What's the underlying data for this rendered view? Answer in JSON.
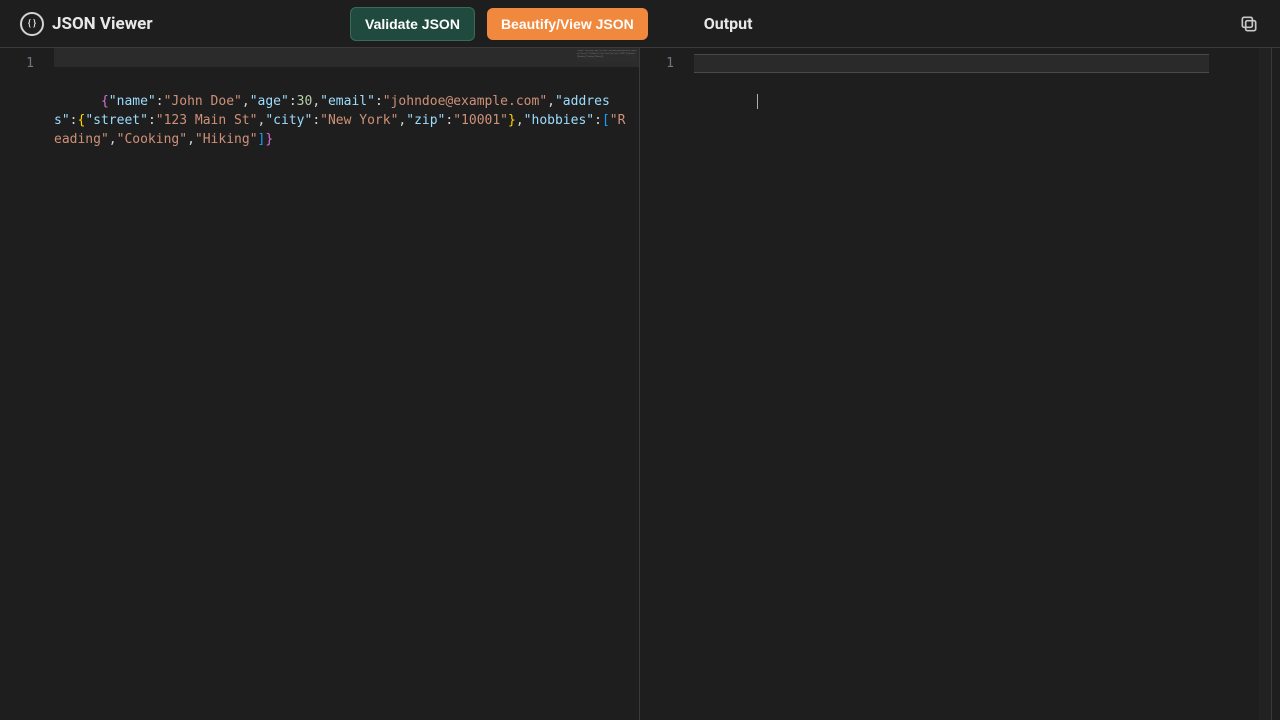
{
  "header": {
    "app_name": "JSON Viewer",
    "logo_abbrev": "{ }",
    "validate_label": "Validate JSON",
    "beautify_label": "Beautify/View JSON",
    "output_label": "Output"
  },
  "input_editor": {
    "line_numbers": [
      "1"
    ],
    "json": {
      "name": "John Doe",
      "age": 30,
      "email": "johndoe@example.com",
      "address": {
        "street": "123 Main St",
        "city": "New York",
        "zip": "10001"
      },
      "hobbies": [
        "Reading",
        "Cooking",
        "Hiking"
      ]
    },
    "raw_display_tokens": [
      {
        "t": "brace",
        "v": "{"
      },
      {
        "t": "key",
        "v": "\"name\""
      },
      {
        "t": "punc",
        "v": ":"
      },
      {
        "t": "str",
        "v": "\"John Doe\""
      },
      {
        "t": "punc",
        "v": ","
      },
      {
        "t": "key",
        "v": "\"age\""
      },
      {
        "t": "punc",
        "v": ":"
      },
      {
        "t": "num",
        "v": "30"
      },
      {
        "t": "punc",
        "v": ","
      },
      {
        "t": "key",
        "v": "\"email\""
      },
      {
        "t": "punc",
        "v": ":"
      },
      {
        "t": "str",
        "v": "\"johndoe@example.com\""
      },
      {
        "t": "punc",
        "v": ","
      },
      {
        "t": "key",
        "v": "\"address\""
      },
      {
        "t": "punc",
        "v": ":"
      },
      {
        "t": "brace2",
        "v": "{"
      },
      {
        "t": "key",
        "v": "\"street\""
      },
      {
        "t": "punc",
        "v": ":"
      },
      {
        "t": "str",
        "v": "\"123 Main St\""
      },
      {
        "t": "punc",
        "v": ","
      },
      {
        "t": "key",
        "v": "\"city\""
      },
      {
        "t": "punc",
        "v": ":"
      },
      {
        "t": "str",
        "v": "\"New York\""
      },
      {
        "t": "punc",
        "v": ","
      },
      {
        "t": "key",
        "v": "\"zip\""
      },
      {
        "t": "punc",
        "v": ":"
      },
      {
        "t": "str",
        "v": "\"10001\""
      },
      {
        "t": "brace2",
        "v": "}"
      },
      {
        "t": "punc",
        "v": ","
      },
      {
        "t": "key",
        "v": "\"hobbies\""
      },
      {
        "t": "punc",
        "v": ":"
      },
      {
        "t": "bracket",
        "v": "["
      },
      {
        "t": "str",
        "v": "\"Reading\""
      },
      {
        "t": "punc",
        "v": ","
      },
      {
        "t": "str",
        "v": "\"Cooking\""
      },
      {
        "t": "punc",
        "v": ","
      },
      {
        "t": "str",
        "v": "\"Hiking\""
      },
      {
        "t": "bracket",
        "v": "]"
      },
      {
        "t": "brace",
        "v": "}"
      }
    ]
  },
  "output_editor": {
    "line_numbers": [
      "1"
    ],
    "content": ""
  },
  "colors": {
    "bg": "#1e1e1e",
    "accent_green": "#1f4a3d",
    "accent_orange": "#f0883e",
    "key": "#9cdcfe",
    "string": "#ce9178",
    "number": "#b5cea8",
    "brace1": "#da70d6",
    "brace2": "#ffd602",
    "bracket": "#179fff"
  }
}
